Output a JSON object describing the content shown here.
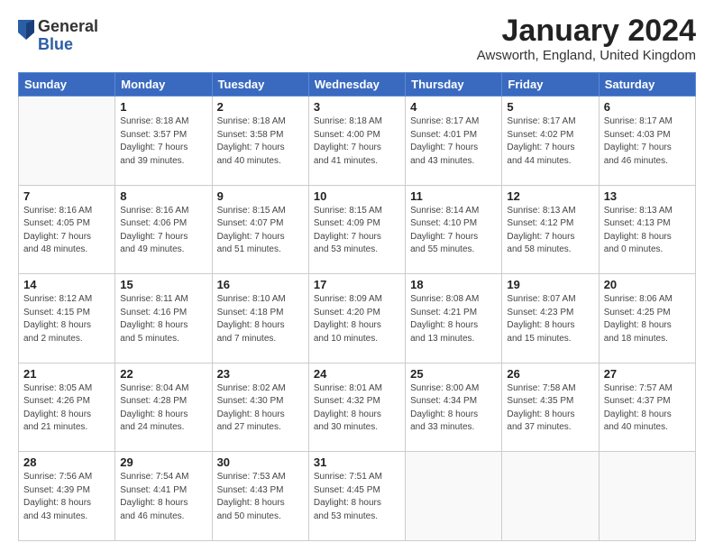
{
  "logo": {
    "general": "General",
    "blue": "Blue"
  },
  "title": "January 2024",
  "location": "Awsworth, England, United Kingdom",
  "days_of_week": [
    "Sunday",
    "Monday",
    "Tuesday",
    "Wednesday",
    "Thursday",
    "Friday",
    "Saturday"
  ],
  "weeks": [
    [
      {
        "day": "",
        "info": ""
      },
      {
        "day": "1",
        "info": "Sunrise: 8:18 AM\nSunset: 3:57 PM\nDaylight: 7 hours\nand 39 minutes."
      },
      {
        "day": "2",
        "info": "Sunrise: 8:18 AM\nSunset: 3:58 PM\nDaylight: 7 hours\nand 40 minutes."
      },
      {
        "day": "3",
        "info": "Sunrise: 8:18 AM\nSunset: 4:00 PM\nDaylight: 7 hours\nand 41 minutes."
      },
      {
        "day": "4",
        "info": "Sunrise: 8:17 AM\nSunset: 4:01 PM\nDaylight: 7 hours\nand 43 minutes."
      },
      {
        "day": "5",
        "info": "Sunrise: 8:17 AM\nSunset: 4:02 PM\nDaylight: 7 hours\nand 44 minutes."
      },
      {
        "day": "6",
        "info": "Sunrise: 8:17 AM\nSunset: 4:03 PM\nDaylight: 7 hours\nand 46 minutes."
      }
    ],
    [
      {
        "day": "7",
        "info": "Sunrise: 8:16 AM\nSunset: 4:05 PM\nDaylight: 7 hours\nand 48 minutes."
      },
      {
        "day": "8",
        "info": "Sunrise: 8:16 AM\nSunset: 4:06 PM\nDaylight: 7 hours\nand 49 minutes."
      },
      {
        "day": "9",
        "info": "Sunrise: 8:15 AM\nSunset: 4:07 PM\nDaylight: 7 hours\nand 51 minutes."
      },
      {
        "day": "10",
        "info": "Sunrise: 8:15 AM\nSunset: 4:09 PM\nDaylight: 7 hours\nand 53 minutes."
      },
      {
        "day": "11",
        "info": "Sunrise: 8:14 AM\nSunset: 4:10 PM\nDaylight: 7 hours\nand 55 minutes."
      },
      {
        "day": "12",
        "info": "Sunrise: 8:13 AM\nSunset: 4:12 PM\nDaylight: 7 hours\nand 58 minutes."
      },
      {
        "day": "13",
        "info": "Sunrise: 8:13 AM\nSunset: 4:13 PM\nDaylight: 8 hours\nand 0 minutes."
      }
    ],
    [
      {
        "day": "14",
        "info": "Sunrise: 8:12 AM\nSunset: 4:15 PM\nDaylight: 8 hours\nand 2 minutes."
      },
      {
        "day": "15",
        "info": "Sunrise: 8:11 AM\nSunset: 4:16 PM\nDaylight: 8 hours\nand 5 minutes."
      },
      {
        "day": "16",
        "info": "Sunrise: 8:10 AM\nSunset: 4:18 PM\nDaylight: 8 hours\nand 7 minutes."
      },
      {
        "day": "17",
        "info": "Sunrise: 8:09 AM\nSunset: 4:20 PM\nDaylight: 8 hours\nand 10 minutes."
      },
      {
        "day": "18",
        "info": "Sunrise: 8:08 AM\nSunset: 4:21 PM\nDaylight: 8 hours\nand 13 minutes."
      },
      {
        "day": "19",
        "info": "Sunrise: 8:07 AM\nSunset: 4:23 PM\nDaylight: 8 hours\nand 15 minutes."
      },
      {
        "day": "20",
        "info": "Sunrise: 8:06 AM\nSunset: 4:25 PM\nDaylight: 8 hours\nand 18 minutes."
      }
    ],
    [
      {
        "day": "21",
        "info": "Sunrise: 8:05 AM\nSunset: 4:26 PM\nDaylight: 8 hours\nand 21 minutes."
      },
      {
        "day": "22",
        "info": "Sunrise: 8:04 AM\nSunset: 4:28 PM\nDaylight: 8 hours\nand 24 minutes."
      },
      {
        "day": "23",
        "info": "Sunrise: 8:02 AM\nSunset: 4:30 PM\nDaylight: 8 hours\nand 27 minutes."
      },
      {
        "day": "24",
        "info": "Sunrise: 8:01 AM\nSunset: 4:32 PM\nDaylight: 8 hours\nand 30 minutes."
      },
      {
        "day": "25",
        "info": "Sunrise: 8:00 AM\nSunset: 4:34 PM\nDaylight: 8 hours\nand 33 minutes."
      },
      {
        "day": "26",
        "info": "Sunrise: 7:58 AM\nSunset: 4:35 PM\nDaylight: 8 hours\nand 37 minutes."
      },
      {
        "day": "27",
        "info": "Sunrise: 7:57 AM\nSunset: 4:37 PM\nDaylight: 8 hours\nand 40 minutes."
      }
    ],
    [
      {
        "day": "28",
        "info": "Sunrise: 7:56 AM\nSunset: 4:39 PM\nDaylight: 8 hours\nand 43 minutes."
      },
      {
        "day": "29",
        "info": "Sunrise: 7:54 AM\nSunset: 4:41 PM\nDaylight: 8 hours\nand 46 minutes."
      },
      {
        "day": "30",
        "info": "Sunrise: 7:53 AM\nSunset: 4:43 PM\nDaylight: 8 hours\nand 50 minutes."
      },
      {
        "day": "31",
        "info": "Sunrise: 7:51 AM\nSunset: 4:45 PM\nDaylight: 8 hours\nand 53 minutes."
      },
      {
        "day": "",
        "info": ""
      },
      {
        "day": "",
        "info": ""
      },
      {
        "day": "",
        "info": ""
      }
    ]
  ]
}
